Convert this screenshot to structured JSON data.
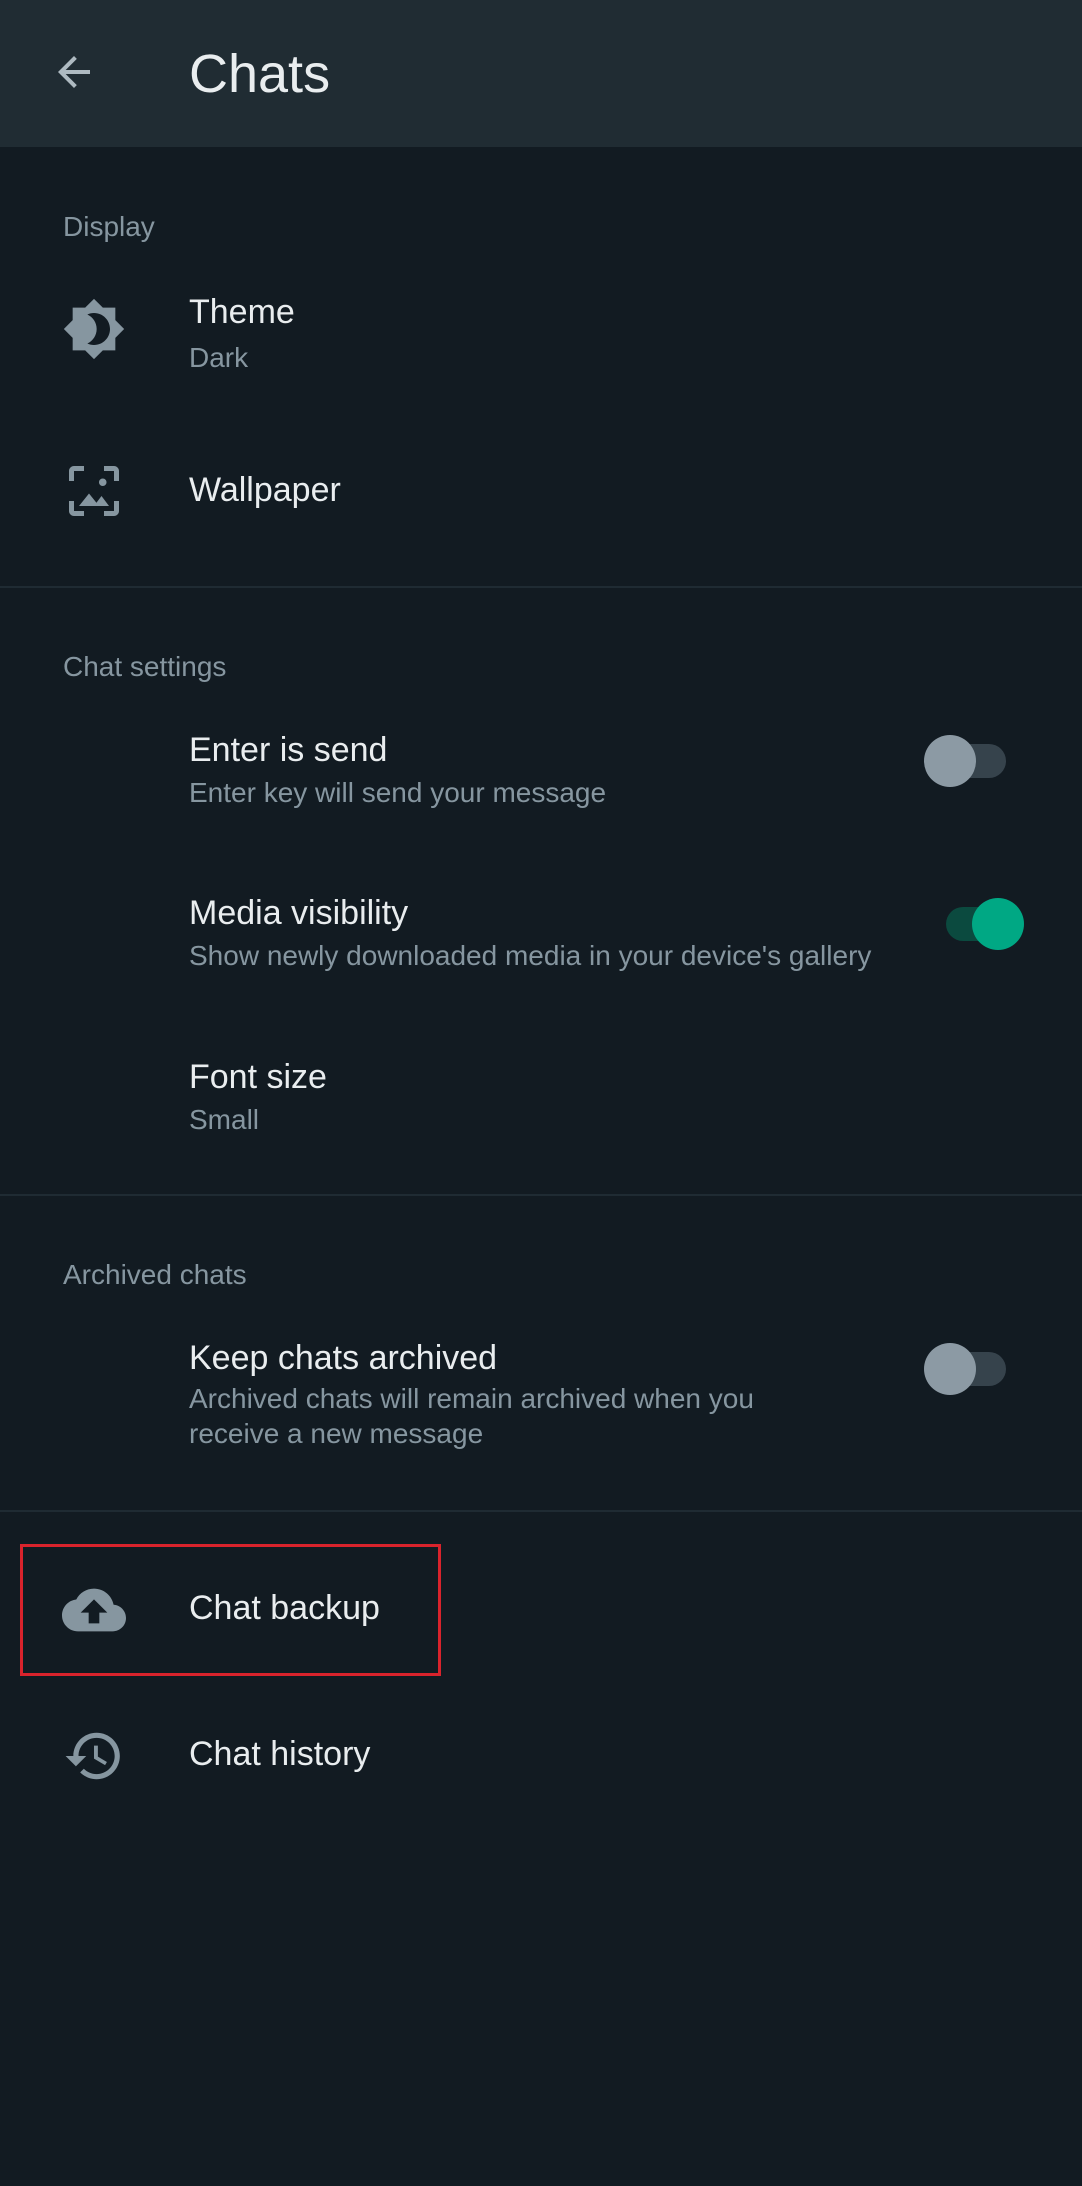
{
  "appbar": {
    "title": "Chats",
    "back_icon": "arrow-left-icon"
  },
  "sections": {
    "display": {
      "header": "Display",
      "theme": {
        "title": "Theme",
        "value": "Dark",
        "icon": "brightness-icon"
      },
      "wallpaper": {
        "title": "Wallpaper",
        "icon": "wallpaper-icon"
      }
    },
    "chat_settings": {
      "header": "Chat settings",
      "enter_is_send": {
        "title": "Enter is send",
        "subtitle": "Enter key will send your message",
        "enabled": false
      },
      "media_visibility": {
        "title": "Media visibility",
        "subtitle": "Show newly downloaded media in your device's gallery",
        "enabled": true
      },
      "font_size": {
        "title": "Font size",
        "value": "Small"
      }
    },
    "archived_chats": {
      "header": "Archived chats",
      "keep_archived": {
        "title": "Keep chats archived",
        "subtitle": "Archived chats will remain archived when you receive a new message",
        "enabled": false
      }
    },
    "other": {
      "chat_backup": {
        "title": "Chat backup",
        "icon": "cloud-upload-icon"
      },
      "chat_history": {
        "title": "Chat history",
        "icon": "history-icon"
      }
    }
  },
  "colors": {
    "background": "#121b22",
    "appbar": "#202c33",
    "primary_text": "#e9edef",
    "secondary_text": "#8696a0",
    "accent": "#00a884",
    "highlight": "#d9232c"
  }
}
